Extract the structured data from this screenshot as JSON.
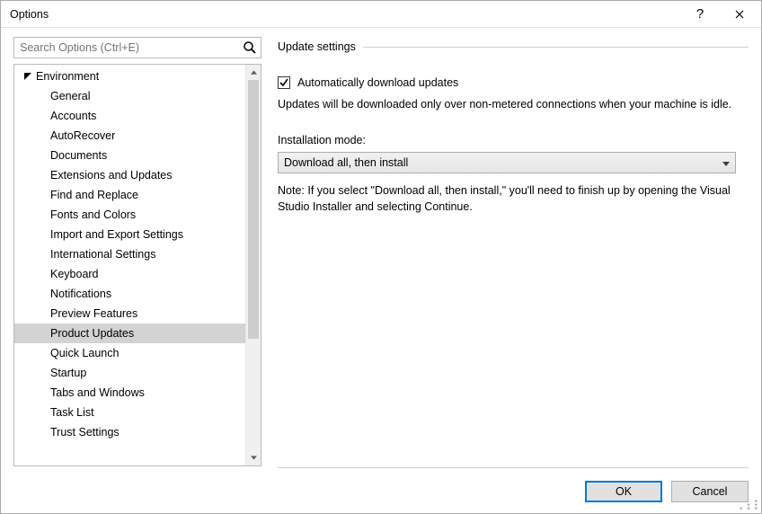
{
  "window": {
    "title": "Options"
  },
  "search": {
    "placeholder": "Search Options (Ctrl+E)"
  },
  "tree": {
    "parent": {
      "label": "Environment",
      "expanded": true
    },
    "items": [
      {
        "label": "General"
      },
      {
        "label": "Accounts"
      },
      {
        "label": "AutoRecover"
      },
      {
        "label": "Documents"
      },
      {
        "label": "Extensions and Updates"
      },
      {
        "label": "Find and Replace"
      },
      {
        "label": "Fonts and Colors"
      },
      {
        "label": "Import and Export Settings"
      },
      {
        "label": "International Settings"
      },
      {
        "label": "Keyboard"
      },
      {
        "label": "Notifications"
      },
      {
        "label": "Preview Features"
      },
      {
        "label": "Product Updates",
        "selected": true
      },
      {
        "label": "Quick Launch"
      },
      {
        "label": "Startup"
      },
      {
        "label": "Tabs and Windows"
      },
      {
        "label": "Task List"
      },
      {
        "label": "Trust Settings"
      }
    ]
  },
  "panel": {
    "header": "Update settings",
    "auto_download_label": "Automatically download updates",
    "auto_download_checked": true,
    "auto_download_desc": "Updates will be downloaded only over non-metered connections when your machine is idle.",
    "install_mode_label": "Installation mode:",
    "install_mode_value": "Download all, then install",
    "note": "Note: If you select \"Download all, then install,\" you'll need to finish up by opening the Visual Studio Installer and selecting Continue."
  },
  "buttons": {
    "ok": "OK",
    "cancel": "Cancel"
  }
}
